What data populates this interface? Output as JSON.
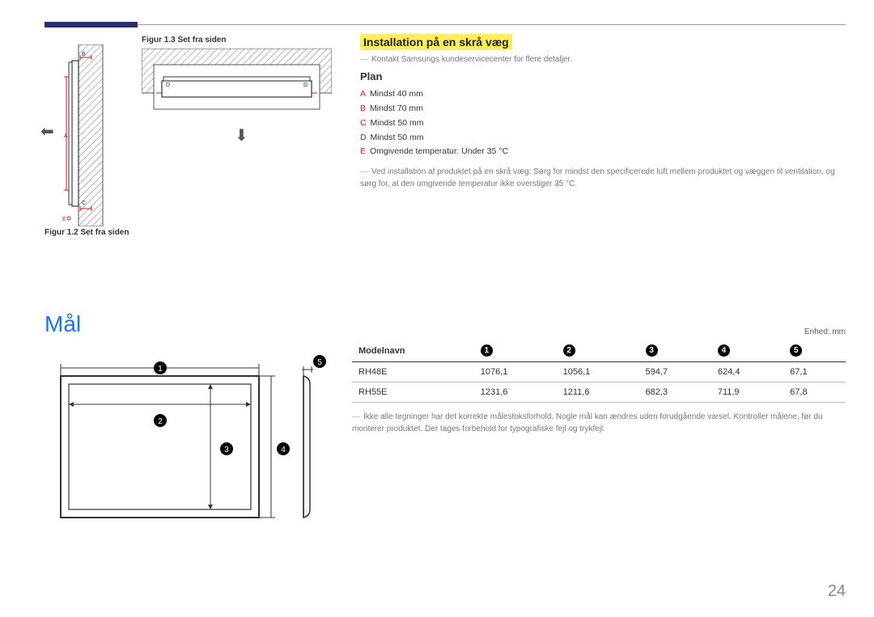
{
  "figures": {
    "fig13_caption": "Figur 1.3 Set fra siden",
    "fig12_caption": "Figur 1.2 Set fra siden",
    "labels": {
      "A": "A",
      "B": "B",
      "C": "C",
      "D": "D",
      "E": "E"
    }
  },
  "install": {
    "title": "Installation på en skrå væg",
    "note1": "Kontakt Samsungs kundeservicecenter for flere detaljer.",
    "plan_title": "Plan",
    "items": [
      {
        "letter": "A",
        "text": "Mindst 40 mm"
      },
      {
        "letter": "B",
        "text": "Mindst 70 mm"
      },
      {
        "letter": "C",
        "text": "Mindst 50 mm"
      },
      {
        "letter": "D",
        "text": "Mindst 50 mm"
      },
      {
        "letter": "E",
        "text": "Omgivende temperatur: Under 35 °C"
      }
    ],
    "note2": "Ved installation af produktet på en skrå væg: Sørg for mindst den specificerede luft mellem produktet og væggen til ventilation, og sørg for, at den omgivende temperatur ikke overstiger 35 °C."
  },
  "dimensions": {
    "heading": "Mål",
    "unit_label": "Enhed: mm",
    "columns": [
      "Modelnavn",
      "1",
      "2",
      "3",
      "4",
      "5"
    ],
    "rows": [
      {
        "model": "RH48E",
        "v": [
          "1076,1",
          "1056,1",
          "594,7",
          "624,4",
          "67,1"
        ]
      },
      {
        "model": "RH55E",
        "v": [
          "1231,6",
          "1211,6",
          "682,3",
          "711,9",
          "67,8"
        ]
      }
    ],
    "note": "Ikke alle tegninger har det korrekte målestoksforhold. Nogle mål kan ændres uden forudgående varsel. Kontroller målene, før du monterer produktet. Der tages forbehold for typografiske fejl og trykfejl."
  },
  "chart_data": {
    "type": "table",
    "title": "Mål",
    "unit": "mm",
    "columns": [
      "Modelnavn",
      "1",
      "2",
      "3",
      "4",
      "5"
    ],
    "rows": [
      [
        "RH48E",
        1076.1,
        1056.1,
        594.7,
        624.4,
        67.1
      ],
      [
        "RH55E",
        1231.6,
        1211.6,
        682.3,
        711.9,
        67.8
      ]
    ]
  },
  "page_number": "24"
}
